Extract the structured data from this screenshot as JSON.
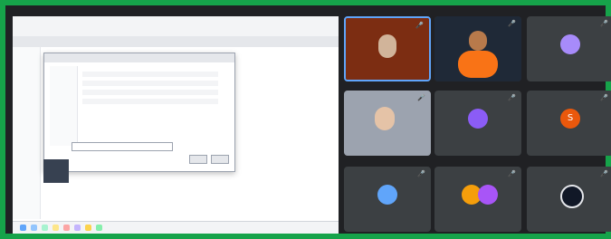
{
  "meeting": {
    "accent": "#16a34a",
    "participants": [
      {
        "name": "",
        "avatar_text": "",
        "mic_icon": "mic-icon"
      },
      {
        "name": "",
        "avatar_text": "",
        "mic_icon": "mic-icon"
      },
      {
        "name": "",
        "avatar_text": "",
        "mic_icon": "mic-icon"
      },
      {
        "name": "",
        "avatar_text": "",
        "mic_icon": "mic-icon"
      },
      {
        "name": "",
        "avatar_text": "",
        "mic_icon": "mic-icon"
      },
      {
        "name": "",
        "avatar_text": "S",
        "mic_icon": "mic-icon"
      },
      {
        "name": "",
        "avatar_text": "",
        "mic_icon": "mic-icon"
      },
      {
        "name": "",
        "avatar_text": "",
        "mic_icon": "mic-icon"
      },
      {
        "name": "",
        "avatar_text": "",
        "mic_icon": "mic-icon"
      }
    ]
  },
  "shared_screen": {
    "app_title": "",
    "dialog": {
      "title": "",
      "button_ok": "",
      "button_cancel": ""
    }
  }
}
